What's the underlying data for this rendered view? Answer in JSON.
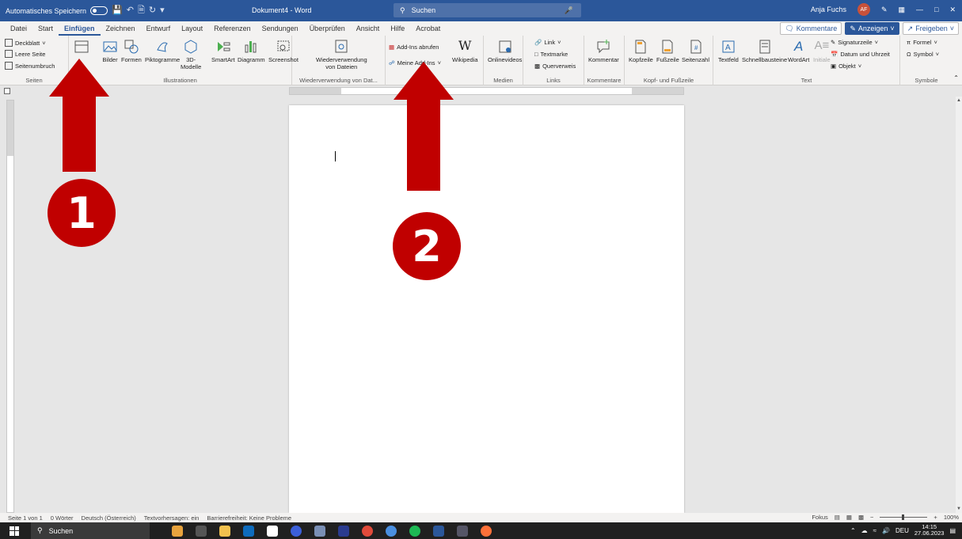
{
  "titlebar": {
    "autosave_label": "Automatisches Speichern",
    "doc_title": "Dokument4 - Word",
    "search_placeholder": "Suchen",
    "user_name": "Anja Fuchs",
    "user_initials": "AF"
  },
  "menu": {
    "tabs": [
      "Datei",
      "Start",
      "Einfügen",
      "Zeichnen",
      "Entwurf",
      "Layout",
      "Referenzen",
      "Sendungen",
      "Überprüfen",
      "Ansicht",
      "Hilfe",
      "Acrobat"
    ],
    "active_tab": "Einfügen",
    "comments_label": "Kommentare",
    "view_label": "Anzeigen",
    "share_label": "Freigeben"
  },
  "ribbon": {
    "seiten": {
      "label": "Seiten",
      "deckblatt": "Deckblatt",
      "leere_seite": "Leere Seite",
      "seitenumbruch": "Seitenumbruch"
    },
    "illustrationen": {
      "label": "Illustrationen",
      "bilder": "Bilder",
      "formen": "Formen",
      "piktogramme": "Piktogramme",
      "modelle_1": "3D-",
      "modelle_2": "Modelle",
      "smartart": "SmartArt",
      "diagramm": "Diagramm",
      "screenshot": "Screenshot"
    },
    "wiederverwendung": {
      "label": "Wiederverwendung von Dat...",
      "btn_1": "Wiederverwendung",
      "btn_2": "von Dateien"
    },
    "addins": {
      "abrufen": "Add-Ins abrufen",
      "meine": "Meine Add-Ins",
      "wikipedia": "Wikipedia"
    },
    "medien": {
      "label": "Medien",
      "onlinevideos": "Onlinevideos"
    },
    "links": {
      "label": "Links",
      "link": "Link",
      "textmarke": "Textmarke",
      "querverweis": "Querverweis"
    },
    "kommentare": {
      "label": "Kommentare",
      "kommentar": "Kommentar"
    },
    "kopf": {
      "label": "Kopf- und Fußzeile",
      "kopfzeile": "Kopfzeile",
      "fusszeile": "Fußzeile",
      "seitenzahl": "Seitenzahl"
    },
    "text": {
      "label": "Text",
      "textfeld": "Textfeld",
      "schnellbausteine": "Schnellbausteine",
      "wordart": "WordArt",
      "initiale": "Initiale",
      "signaturzeile": "Signaturzeile",
      "datum": "Datum und Uhrzeit",
      "objekt": "Objekt"
    },
    "symbole": {
      "label": "Symbole",
      "formel": "Formel",
      "symbol": "Symbol"
    }
  },
  "statusbar": {
    "page": "Seite 1 von 1",
    "words": "0 Wörter",
    "language": "Deutsch (Österreich)",
    "predictions": "Textvorhersagen: ein",
    "accessibility": "Barrierefreiheit: Keine Probleme",
    "focus": "Fokus",
    "zoom": "100%"
  },
  "taskbar": {
    "search": "Suchen",
    "language": "DEU",
    "time": "14:15",
    "date": "27.06.2023"
  },
  "annotations": {
    "marker_1": "1",
    "marker_2": "2",
    "color": "#c00000"
  },
  "colors": {
    "titlebar": "#2b579a",
    "ribbon": "#f3f2f1",
    "taskbar": "#202020"
  }
}
